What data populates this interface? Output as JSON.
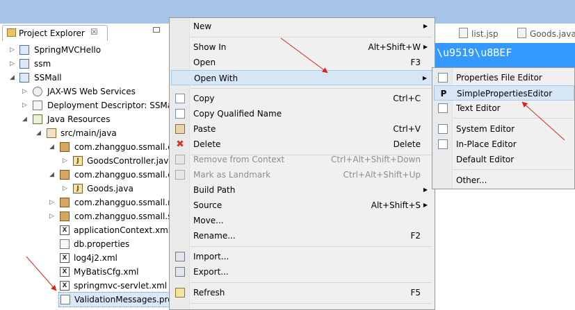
{
  "explorer": {
    "tab_title": "Project Explorer",
    "tab_close": "☒",
    "items": [
      {
        "label": "SpringMVCHello",
        "twisty": "▷",
        "icon": "project-icon"
      },
      {
        "label": "ssm",
        "twisty": "▷",
        "icon": "project-icon"
      },
      {
        "label": "SSMall",
        "twisty": "◢",
        "icon": "project-icon"
      },
      {
        "label": "JAX-WS Web Services",
        "twisty": "▷",
        "icon": "web-services-icon"
      },
      {
        "label": "Deployment Descriptor: SSMall",
        "twisty": "▷",
        "icon": "deployment-descriptor-icon"
      },
      {
        "label": "Java Resources",
        "twisty": "◢",
        "icon": "java-resources-icon"
      },
      {
        "label": "src/main/java",
        "twisty": "◢",
        "icon": "source-folder-icon"
      },
      {
        "label": "com.zhangguo.ssmall.controller",
        "twisty": "◢",
        "icon": "package-icon"
      },
      {
        "label": "GoodsController.java",
        "twisty": "▷",
        "icon": "java-file-icon"
      },
      {
        "label": "com.zhangguo.ssmall.entities",
        "twisty": "◢",
        "icon": "package-icon"
      },
      {
        "label": "Goods.java",
        "twisty": "▷",
        "icon": "java-file-icon"
      },
      {
        "label": "com.zhangguo.ssmall.mapper",
        "twisty": "▷",
        "icon": "package-icon"
      },
      {
        "label": "com.zhangguo.ssmall.services",
        "twisty": "▷",
        "icon": "package-icon"
      },
      {
        "label": "applicationContext.xml",
        "twisty": "",
        "icon": "xml-file-icon"
      },
      {
        "label": "db.properties",
        "twisty": "",
        "icon": "properties-file-icon"
      },
      {
        "label": "log4j2.xml",
        "twisty": "",
        "icon": "xml-file-icon"
      },
      {
        "label": "MyBatisCfg.xml",
        "twisty": "",
        "icon": "xml-file-icon"
      },
      {
        "label": "springmvc-servlet.xml",
        "twisty": "",
        "icon": "xml-file-icon"
      },
      {
        "label": "ValidationMessages.properties",
        "twisty": "",
        "icon": "properties-file-icon"
      }
    ]
  },
  "editor": {
    "tabs": [
      "list.jsp",
      "Goods.java"
    ],
    "highlighted_text": "\\u9519\\u8BEF"
  },
  "context_menu": {
    "items": [
      {
        "label": "New",
        "shortcut": "",
        "submenu": true,
        "icon": ""
      },
      {
        "label": "Show In",
        "shortcut": "Alt+Shift+W",
        "submenu": true,
        "icon": ""
      },
      {
        "label": "Open",
        "shortcut": "F3",
        "submenu": false,
        "icon": ""
      },
      {
        "label": "Open With",
        "shortcut": "",
        "submenu": true,
        "icon": ""
      },
      {
        "label": "Copy",
        "shortcut": "Ctrl+C",
        "submenu": false,
        "icon": "copy-icon"
      },
      {
        "label": "Copy Qualified Name",
        "shortcut": "",
        "submenu": false,
        "icon": "copy-icon"
      },
      {
        "label": "Paste",
        "shortcut": "Ctrl+V",
        "submenu": false,
        "icon": "paste-icon"
      },
      {
        "label": "Delete",
        "shortcut": "Delete",
        "submenu": false,
        "icon": "delete-icon"
      },
      {
        "label": "Remove from Context",
        "shortcut": "Ctrl+Alt+Shift+Down",
        "submenu": false,
        "icon": "remove-context-icon"
      },
      {
        "label": "Mark as Landmark",
        "shortcut": "Ctrl+Alt+Shift+Up",
        "submenu": false,
        "icon": "landmark-icon"
      },
      {
        "label": "Build Path",
        "shortcut": "",
        "submenu": true,
        "icon": ""
      },
      {
        "label": "Source",
        "shortcut": "Alt+Shift+S",
        "submenu": true,
        "icon": ""
      },
      {
        "label": "Move...",
        "shortcut": "",
        "submenu": false,
        "icon": ""
      },
      {
        "label": "Rename...",
        "shortcut": "F2",
        "submenu": false,
        "icon": ""
      },
      {
        "label": "Import...",
        "shortcut": "",
        "submenu": false,
        "icon": "import-icon"
      },
      {
        "label": "Export...",
        "shortcut": "",
        "submenu": false,
        "icon": "export-icon"
      },
      {
        "label": "Refresh",
        "shortcut": "F5",
        "submenu": false,
        "icon": "refresh-icon"
      }
    ]
  },
  "open_with_submenu": {
    "items": [
      {
        "label": "Properties File Editor",
        "icon": "properties-editor-icon"
      },
      {
        "label": "SimplePropertiesEditor",
        "icon": "simple-properties-editor-icon"
      },
      {
        "label": "Text Editor",
        "icon": "text-editor-icon"
      },
      {
        "label": "System Editor",
        "icon": "system-editor-icon"
      },
      {
        "label": "In-Place Editor",
        "icon": "in-place-editor-icon"
      },
      {
        "label": "Default Editor",
        "icon": ""
      },
      {
        "label": "Other...",
        "icon": ""
      }
    ]
  },
  "glyphs": {
    "submenu_arrow": "▶",
    "simple_editor": "P"
  }
}
